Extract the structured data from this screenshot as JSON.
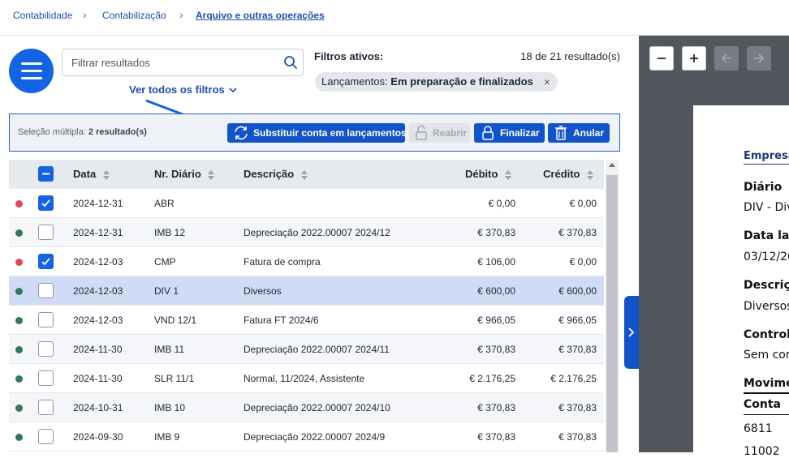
{
  "breadcrumb": {
    "items": [
      "Contabilidade",
      "Contabilização",
      "Arquivo e outras operações"
    ]
  },
  "search": {
    "placeholder": "Filtrar resultados"
  },
  "filters": {
    "see_all": "Ver todos os filtros",
    "active_label": "Filtros ativos:",
    "results_count": "18 de 21 resultado(s)",
    "chip_prefix": "Lançamentos:",
    "chip_value": "Em preparação e finalizados",
    "chip_close": "×"
  },
  "bulk": {
    "label": "Seleção múltipla:",
    "count": "2 resultado(s)",
    "replace": "Substituir conta em lançamentos",
    "reopen": "Reabrir",
    "finalize": "Finalizar",
    "cancel": "Anular"
  },
  "table": {
    "headers": {
      "date": "Data",
      "journal": "Nr. Diário",
      "description": "Descrição",
      "debit": "Débito",
      "credit": "Crédito"
    },
    "rows": [
      {
        "status": "red",
        "checked": true,
        "date": "2024-12-31",
        "journal": "ABR",
        "description": "",
        "debit": "€ 0,00",
        "credit": "€ 0,00"
      },
      {
        "status": "green",
        "checked": false,
        "date": "2024-12-31",
        "journal": "IMB 12",
        "description": "Depreciação 2022.00007 2024/12",
        "debit": "€ 370,83",
        "credit": "€ 370,83"
      },
      {
        "status": "red",
        "checked": true,
        "date": "2024-12-03",
        "journal": "CMP",
        "description": "Fatura de compra",
        "debit": "€ 106,00",
        "credit": "€ 0,00"
      },
      {
        "status": "green",
        "checked": false,
        "date": "2024-12-03",
        "journal": "DIV 1",
        "description": "Diversos",
        "debit": "€ 600,00",
        "credit": "€ 600,00"
      },
      {
        "status": "green",
        "checked": false,
        "date": "2024-12-03",
        "journal": "VND 12/1",
        "description": "Fatura FT 2024/6",
        "debit": "€ 966,05",
        "credit": "€ 966,05"
      },
      {
        "status": "green",
        "checked": false,
        "date": "2024-11-30",
        "journal": "IMB 11",
        "description": "Depreciação 2022.00007 2024/11",
        "debit": "€ 370,83",
        "credit": "€ 370,83"
      },
      {
        "status": "green",
        "checked": false,
        "date": "2024-11-30",
        "journal": "SLR 11/1",
        "description": "Normal, 11/2024, Assistente",
        "debit": "€ 2.176,25",
        "credit": "€ 2.176,25"
      },
      {
        "status": "green",
        "checked": false,
        "date": "2024-10-31",
        "journal": "IMB 10",
        "description": "Depreciação 2022.00007 2024/10",
        "debit": "€ 370,83",
        "credit": "€ 370,83"
      },
      {
        "status": "green",
        "checked": false,
        "date": "2024-09-30",
        "journal": "IMB 9",
        "description": "Depreciação 2022.00007 2024/9",
        "debit": "€ 370,83",
        "credit": "€ 370,83"
      }
    ]
  },
  "preview": {
    "company": "Empresa",
    "journal_label": "Diário",
    "journal_value": "DIV - Div",
    "date_label": "Data la",
    "date_value": "03/12/20",
    "desc_label": "Descriç",
    "desc_value": "Diversos",
    "control_label": "Control",
    "control_value": "Sem cor",
    "movements_label": "Movime",
    "account_label": "Conta",
    "account_1": "6811",
    "account_2": "11002"
  },
  "colors": {
    "accent": "#1463e4",
    "status_red": "#e0475a",
    "status_green": "#2f7a55"
  }
}
